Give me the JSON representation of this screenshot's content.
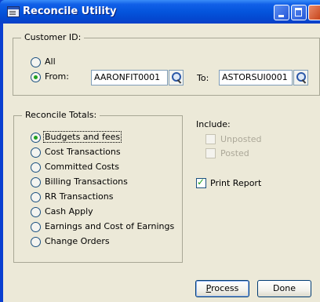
{
  "window": {
    "title": "Reconcile Utility"
  },
  "customer": {
    "group_label": "Customer ID:",
    "all_label": "All",
    "from_label": "From:",
    "from_value": "AARONFIT0001",
    "to_label": "To:",
    "to_value": "ASTORSUI0001",
    "selected": "From"
  },
  "reconcile": {
    "group_label": "Reconcile Totals:",
    "options": [
      "Budgets and fees",
      "Cost Transactions",
      "Committed Costs",
      "Billing Transactions",
      "RR Transactions",
      "Cash Apply",
      "Earnings and Cost of Earnings",
      "Change Orders"
    ],
    "selected_index": 0
  },
  "include": {
    "label": "Include:",
    "unposted_label": "Unposted",
    "unposted_checked": false,
    "posted_label": "Posted",
    "posted_checked": false,
    "enabled": false
  },
  "print_report": {
    "label": "Print Report",
    "checked": true
  },
  "buttons": {
    "process_first": "P",
    "process_rest": "rocess",
    "done": "Done"
  },
  "icons": {
    "title_icon": "app-window-icon",
    "lookup": "magnifier-icon"
  }
}
